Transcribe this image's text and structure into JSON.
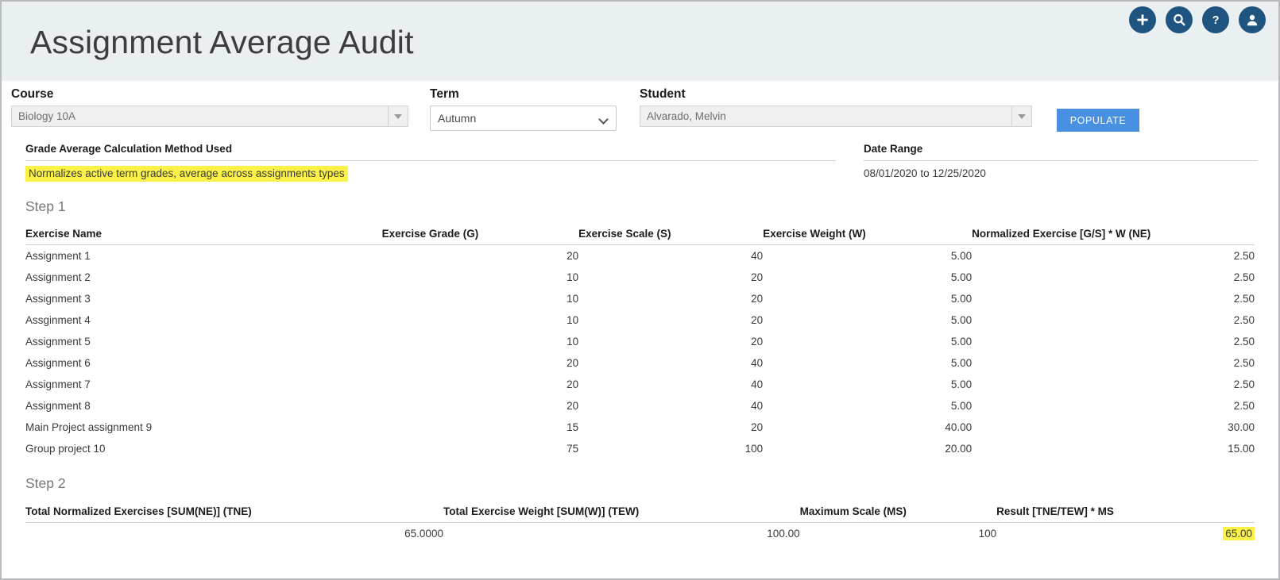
{
  "header": {
    "title": "Assignment Average Audit",
    "icons": [
      {
        "name": "add-icon",
        "glyph": "plus"
      },
      {
        "name": "search-icon",
        "glyph": "magnifier"
      },
      {
        "name": "help-icon",
        "glyph": "question"
      },
      {
        "name": "user-account-icon",
        "glyph": "person"
      }
    ],
    "icon_color": "#1f5481",
    "band_color": "#eaeff2"
  },
  "filters": {
    "course": {
      "label": "Course",
      "value": "Biology 10A",
      "placeholder": "Biology 10A"
    },
    "term": {
      "label": "Term",
      "value": "Autumn",
      "options": [
        "Autumn"
      ]
    },
    "student": {
      "label": "Student",
      "value": "Alvarado, Melvin",
      "placeholder": "Alvarado, Melvin"
    },
    "populate_button": "POPULATE",
    "populate_color": "#4a90e2"
  },
  "info": {
    "method_label": "Grade Average Calculation Method Used",
    "method_value": "Normalizes active term grades, average across assignments types",
    "date_range_label": "Date Range",
    "date_range_value": "08/01/2020 to 12/25/2020",
    "highlight_color": "#fbf147"
  },
  "step1": {
    "heading": "Step 1",
    "columns": [
      "Exercise Name",
      "Exercise Grade (G)",
      "Exercise Scale (S)",
      "Exercise Weight (W)",
      "Normalized Exercise [G/S] * W (NE)"
    ],
    "rows": [
      {
        "name": "Assignment 1",
        "grade": "20",
        "scale": "40",
        "weight": "5.00",
        "normalized": "2.50"
      },
      {
        "name": "Assignment 2",
        "grade": "10",
        "scale": "20",
        "weight": "5.00",
        "normalized": "2.50"
      },
      {
        "name": "Assignment 3",
        "grade": "10",
        "scale": "20",
        "weight": "5.00",
        "normalized": "2.50"
      },
      {
        "name": "Assginment 4",
        "grade": "10",
        "scale": "20",
        "weight": "5.00",
        "normalized": "2.50"
      },
      {
        "name": "Assignment 5",
        "grade": "10",
        "scale": "20",
        "weight": "5.00",
        "normalized": "2.50"
      },
      {
        "name": "Assignment 6",
        "grade": "20",
        "scale": "40",
        "weight": "5.00",
        "normalized": "2.50"
      },
      {
        "name": "Assignment 7",
        "grade": "20",
        "scale": "40",
        "weight": "5.00",
        "normalized": "2.50"
      },
      {
        "name": "Assignment 8",
        "grade": "20",
        "scale": "40",
        "weight": "5.00",
        "normalized": "2.50"
      },
      {
        "name": "Main Project assignment 9",
        "grade": "15",
        "scale": "20",
        "weight": "40.00",
        "normalized": "30.00"
      },
      {
        "name": "Group project 10",
        "grade": "75",
        "scale": "100",
        "weight": "20.00",
        "normalized": "15.00"
      }
    ]
  },
  "step2": {
    "heading": "Step 2",
    "columns": [
      "Total Normalized Exercises [SUM(NE)] (TNE)",
      "Total Exercise Weight [SUM(W)] (TEW)",
      "Maximum Scale (MS)",
      "Result [TNE/TEW] * MS"
    ],
    "row": {
      "tne": "65.0000",
      "tew": "100.00",
      "ms": "100",
      "result": "65.00"
    }
  }
}
